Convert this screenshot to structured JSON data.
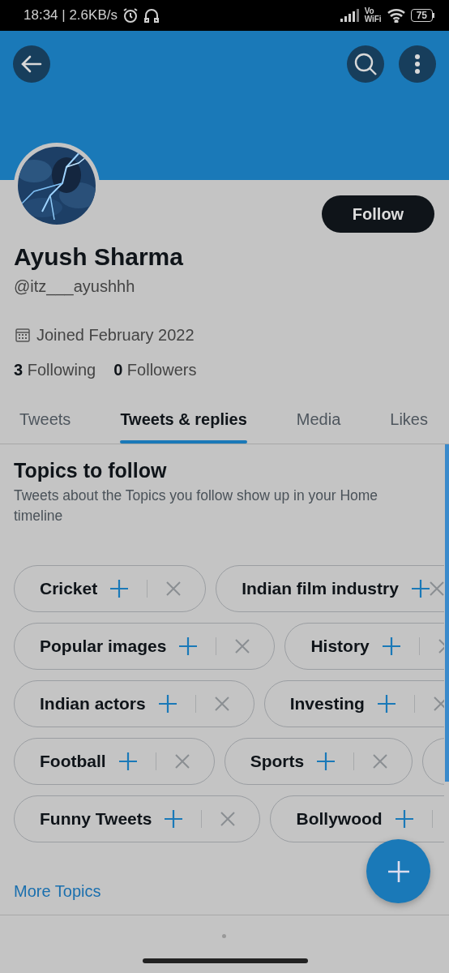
{
  "status_bar": {
    "time_speed": "18:34 | 2.6KB/s",
    "vo": "Vo",
    "wifi": "WiFi",
    "battery": "75"
  },
  "profile": {
    "follow_button": "Follow",
    "name": "Ayush Sharma",
    "handle": "@itz___ayushhh",
    "joined": "Joined February 2022",
    "following_count": "3",
    "following_label": "Following",
    "followers_count": "0",
    "followers_label": "Followers"
  },
  "tabs": [
    {
      "label": "Tweets",
      "selected": false
    },
    {
      "label": "Tweets & replies",
      "selected": true
    },
    {
      "label": "Media",
      "selected": false
    },
    {
      "label": "Likes",
      "selected": false
    }
  ],
  "topics": {
    "title": "Topics to follow",
    "subtitle": "Tweets about the Topics you follow show up in your Home timeline",
    "rows": [
      [
        {
          "kind": "chip",
          "label": "Cricket"
        },
        {
          "kind": "chip",
          "label": "Indian film industry"
        }
      ],
      [
        {
          "kind": "chip",
          "label": "Popular images"
        },
        {
          "kind": "chip",
          "label": "History"
        }
      ],
      [
        {
          "kind": "chip",
          "label": "Indian actors"
        },
        {
          "kind": "chip",
          "label": "Investing"
        }
      ],
      [
        {
          "kind": "chip",
          "label": "Football"
        },
        {
          "kind": "chip",
          "label": "Sports"
        },
        {
          "kind": "edge"
        }
      ],
      [
        {
          "kind": "chip",
          "label": "Funny Tweets"
        },
        {
          "kind": "chip",
          "label": "Bollywood"
        }
      ]
    ],
    "more": "More Topics"
  }
}
